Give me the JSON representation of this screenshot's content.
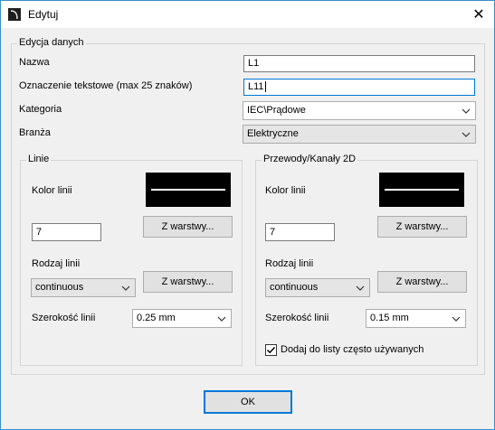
{
  "window": {
    "title": "Edytuj",
    "close_glyph": "✕"
  },
  "edycja": {
    "group_label": "Edycja danych",
    "nazwa_label": "Nazwa",
    "nazwa_value": "L1",
    "oznaczenie_label": "Oznaczenie tekstowe (max 25 znaków)",
    "oznaczenie_value": "L11",
    "kategoria_label": "Kategoria",
    "kategoria_value": "IEC\\Prądowe",
    "branza_label": "Branża",
    "branza_value": "Elektryczne"
  },
  "linie": {
    "group_label": "Linie",
    "kolor_label": "Kolor linii",
    "kolor_value": "7",
    "z_warstwy_color": "Z warstwy...",
    "rodzaj_label": "Rodzaj linii",
    "rodzaj_value": "continuous",
    "z_warstwy_type": "Z warstwy...",
    "szerokosc_label": "Szerokość linii",
    "szerokosc_value": "0.25 mm",
    "swatch_color": "#000000"
  },
  "przewody": {
    "group_label": "Przewody/Kanały 2D",
    "kolor_label": "Kolor linii",
    "kolor_value": "7",
    "z_warstwy_color": "Z warstwy...",
    "rodzaj_label": "Rodzaj linii",
    "rodzaj_value": "continuous",
    "z_warstwy_type": "Z warstwy...",
    "szerokosc_label": "Szerokość linii",
    "szerokosc_value": "0.15 mm",
    "swatch_color": "#000000",
    "checkbox_label": "Dodaj do listy często używanych",
    "checkbox_checked": true
  },
  "ok_label": "OK",
  "accent_color": "#0078d7",
  "icons": [
    "app-icon",
    "close-icon",
    "chevron-down-icon",
    "check-icon"
  ]
}
